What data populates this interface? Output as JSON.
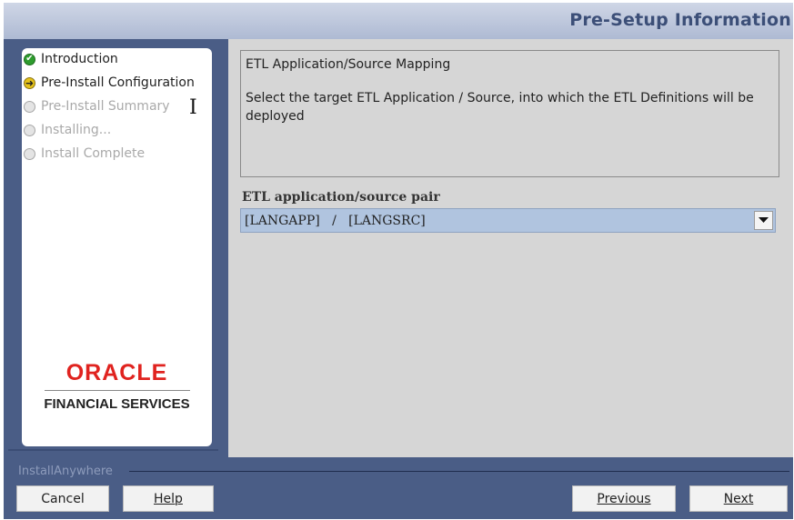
{
  "window": {
    "title": "Pre-Setup Information",
    "accent_color": "#4a5d86",
    "title_color": "#3c4f78"
  },
  "steps": [
    {
      "label": "Introduction",
      "status": "done",
      "icon": "check-icon"
    },
    {
      "label": "Pre-Install Configuration",
      "status": "current",
      "icon": "arrow-right-icon"
    },
    {
      "label": "Pre-Install Summary",
      "status": "pending",
      "icon": "circle-icon"
    },
    {
      "label": "Installing...",
      "status": "pending",
      "icon": "circle-icon"
    },
    {
      "label": "Install Complete",
      "status": "pending",
      "icon": "circle-icon"
    }
  ],
  "branding": {
    "logo_text": "ORACLE",
    "subtitle": "FINANCIAL SERVICES",
    "logo_color": "#e0231f"
  },
  "main": {
    "info_title": "ETL Application/Source Mapping",
    "info_text": "Select the target ETL Application / Source, into which the ETL Definitions will be deployed",
    "field_label": "ETL application/source pair",
    "dropdown_value": "[LANGAPP]   /   [LANGSRC]"
  },
  "footer": {
    "installer_name": "InstallAnywhere",
    "cancel_label": "Cancel",
    "help_label": "Help",
    "previous_label": "Previous",
    "next_label": "Next"
  }
}
